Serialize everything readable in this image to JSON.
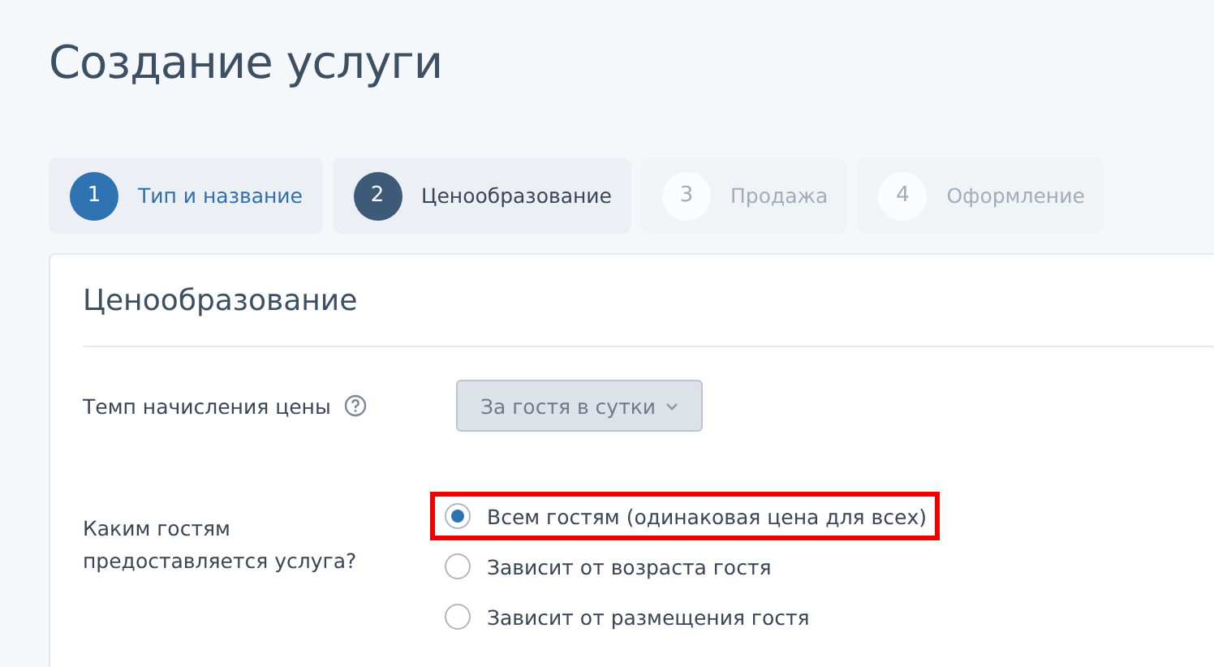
{
  "page_title": "Создание услуги",
  "steps": [
    {
      "number": "1",
      "label": "Тип и название",
      "completed": true,
      "selected": false
    },
    {
      "number": "2",
      "label": "Ценообразование",
      "completed": false,
      "selected": true
    },
    {
      "number": "3",
      "label": "Продажа",
      "completed": false,
      "selected": false
    },
    {
      "number": "4",
      "label": "Оформление",
      "completed": false,
      "selected": false
    }
  ],
  "section": {
    "title": "Ценообразование",
    "rate": {
      "label": "Темп начисления цены",
      "value": "За гостя в сутки",
      "disabled": true
    },
    "guests": {
      "label": "Каким гостям предоставляется услуга?",
      "options": [
        {
          "label": "Всем гостям (одинаковая цена для всех)",
          "selected": true,
          "highlighted": true
        },
        {
          "label": "Зависит от возраста гостя",
          "selected": false,
          "highlighted": false
        },
        {
          "label": "Зависит от размещения гостя",
          "selected": false,
          "highlighted": false
        }
      ]
    }
  }
}
